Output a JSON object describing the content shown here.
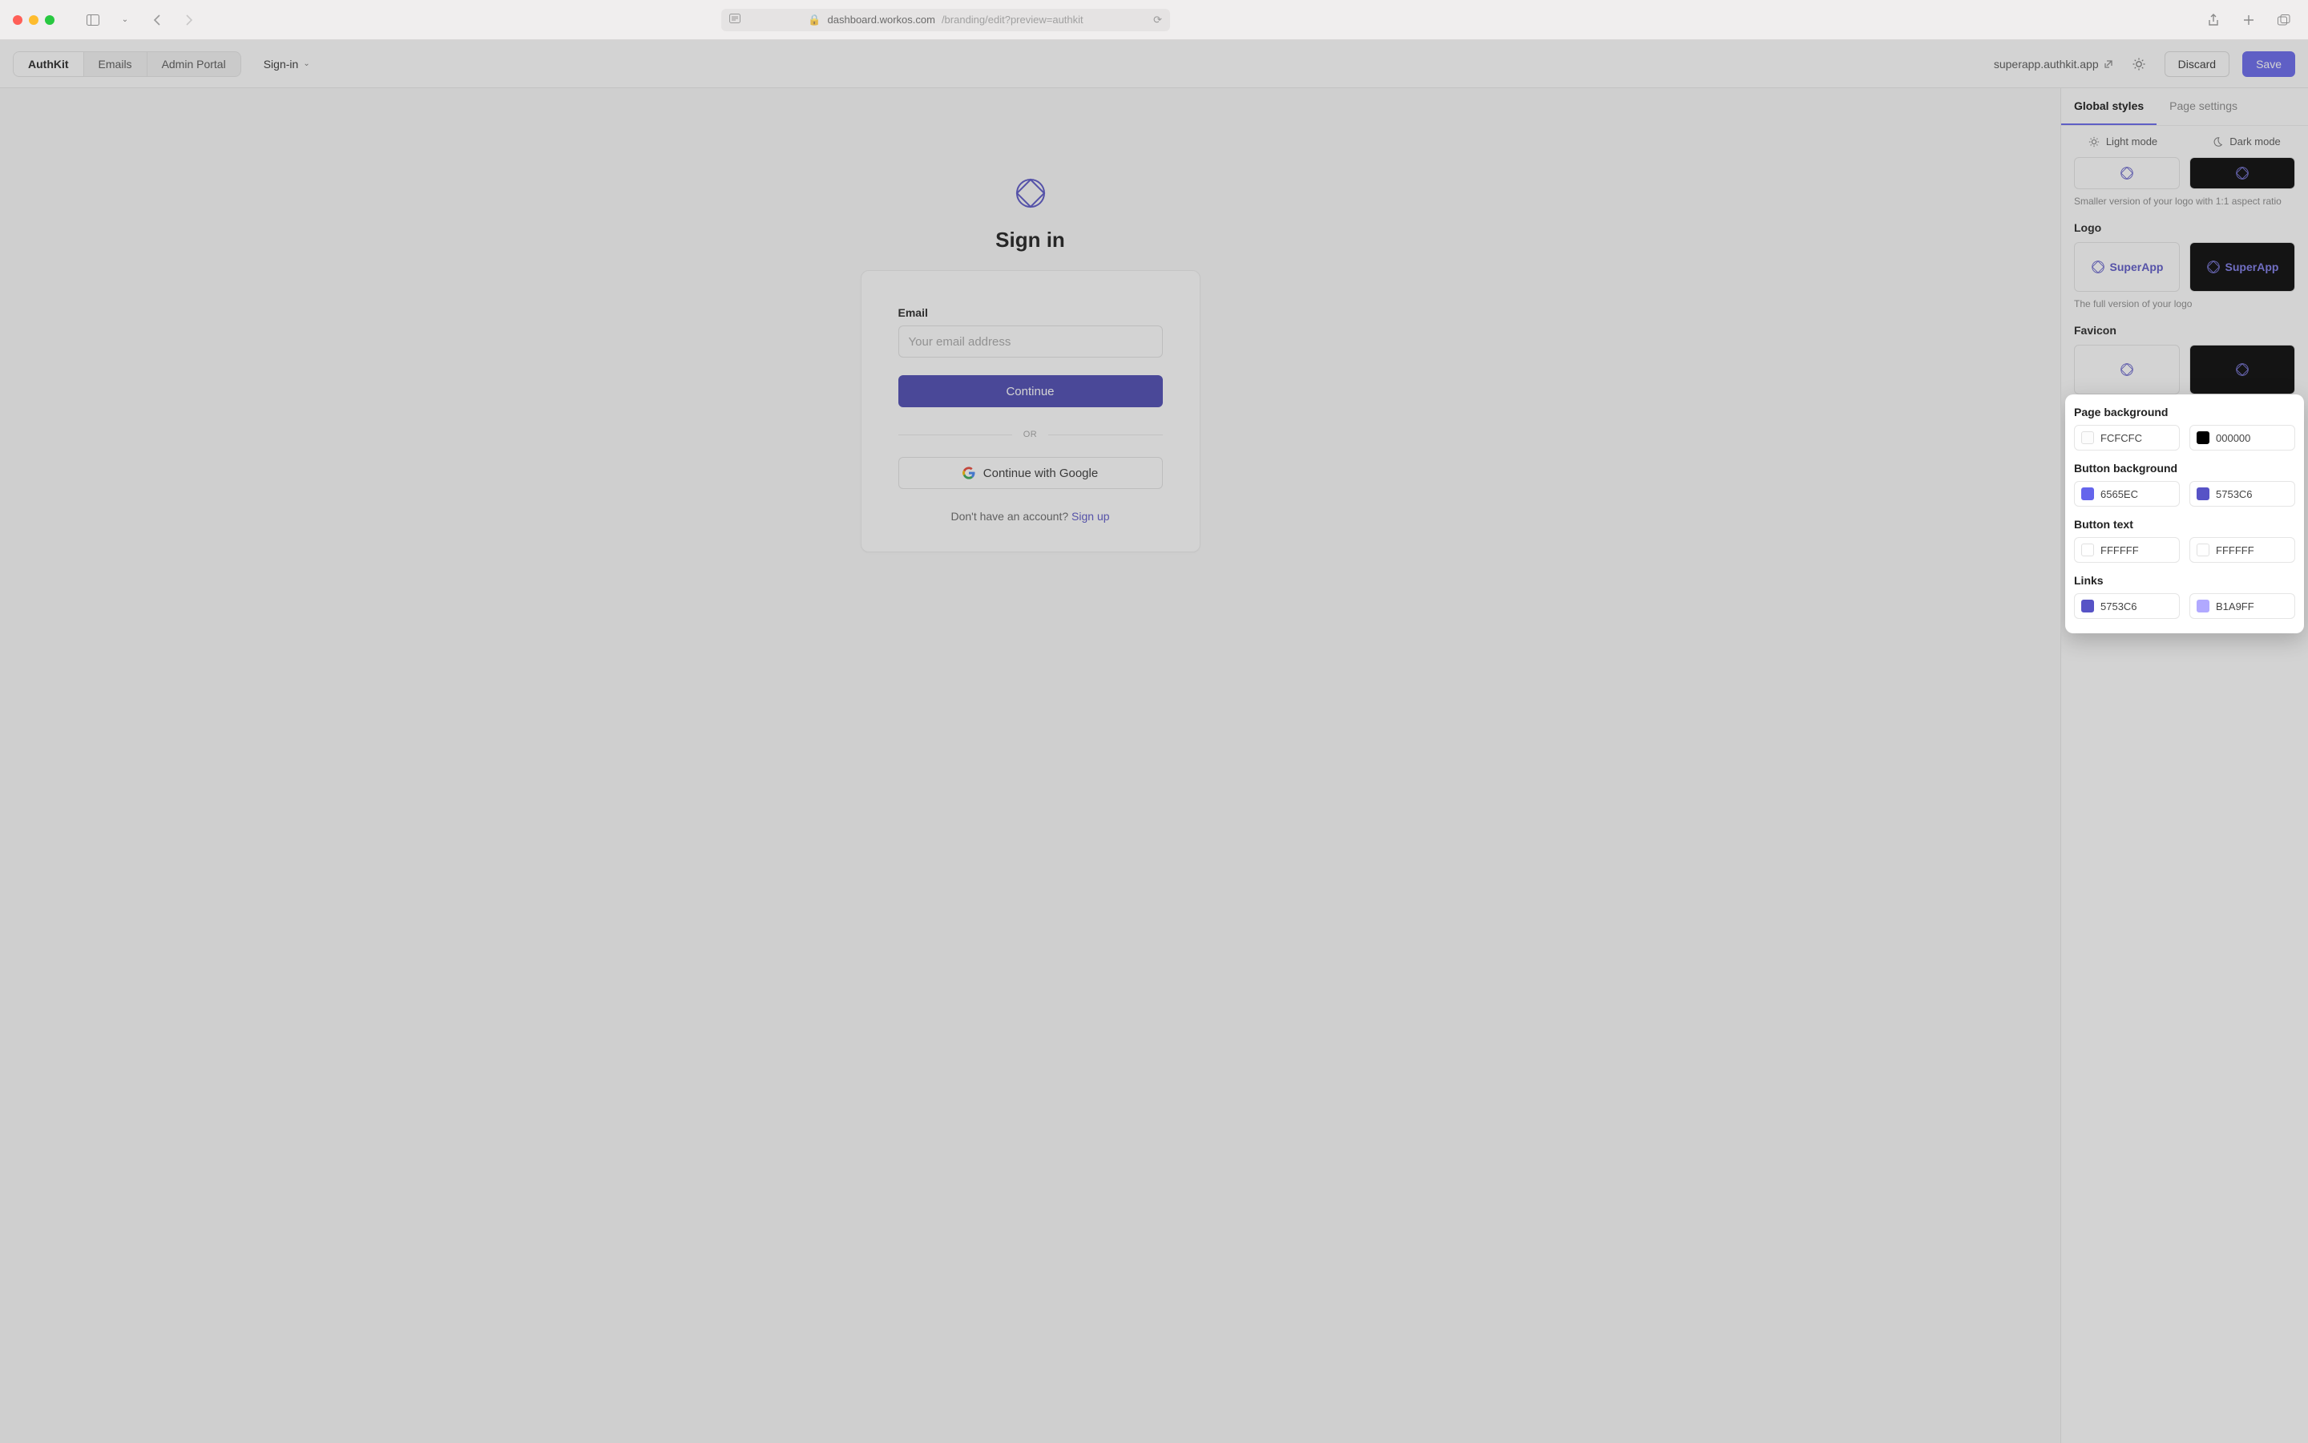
{
  "browser": {
    "url_secure_host": "dashboard.workos.com",
    "url_path": "/branding/edit?preview=authkit"
  },
  "header": {
    "tabs": [
      "AuthKit",
      "Emails",
      "Admin Portal"
    ],
    "dropdown": "Sign-in",
    "domain": "superapp.authkit.app",
    "discard": "Discard",
    "save": "Save"
  },
  "preview": {
    "title": "Sign in",
    "email_label": "Email",
    "email_placeholder": "Your email address",
    "continue": "Continue",
    "or": "OR",
    "google": "Continue with Google",
    "no_account": "Don't have an account? ",
    "signup": "Sign up"
  },
  "panel": {
    "tabs": {
      "global": "Global styles",
      "page": "Page settings"
    },
    "modes": {
      "light": "Light mode",
      "dark": "Dark mode"
    },
    "logomark_help": "Smaller version of your logo with 1:1 aspect ratio",
    "logo_label": "Logo",
    "logo_text": "SuperApp",
    "logo_help": "The full version of your logo",
    "favicon_label": "Favicon",
    "colors": {
      "page_bg": {
        "label": "Page background",
        "light": "FCFCFC",
        "dark": "000000"
      },
      "btn_bg": {
        "label": "Button background",
        "light": "6565EC",
        "dark": "5753C6"
      },
      "btn_txt": {
        "label": "Button text",
        "light": "FFFFFF",
        "dark": "FFFFFF"
      },
      "links": {
        "label": "Links",
        "light": "5753C6",
        "dark": "B1A9FF"
      }
    }
  }
}
